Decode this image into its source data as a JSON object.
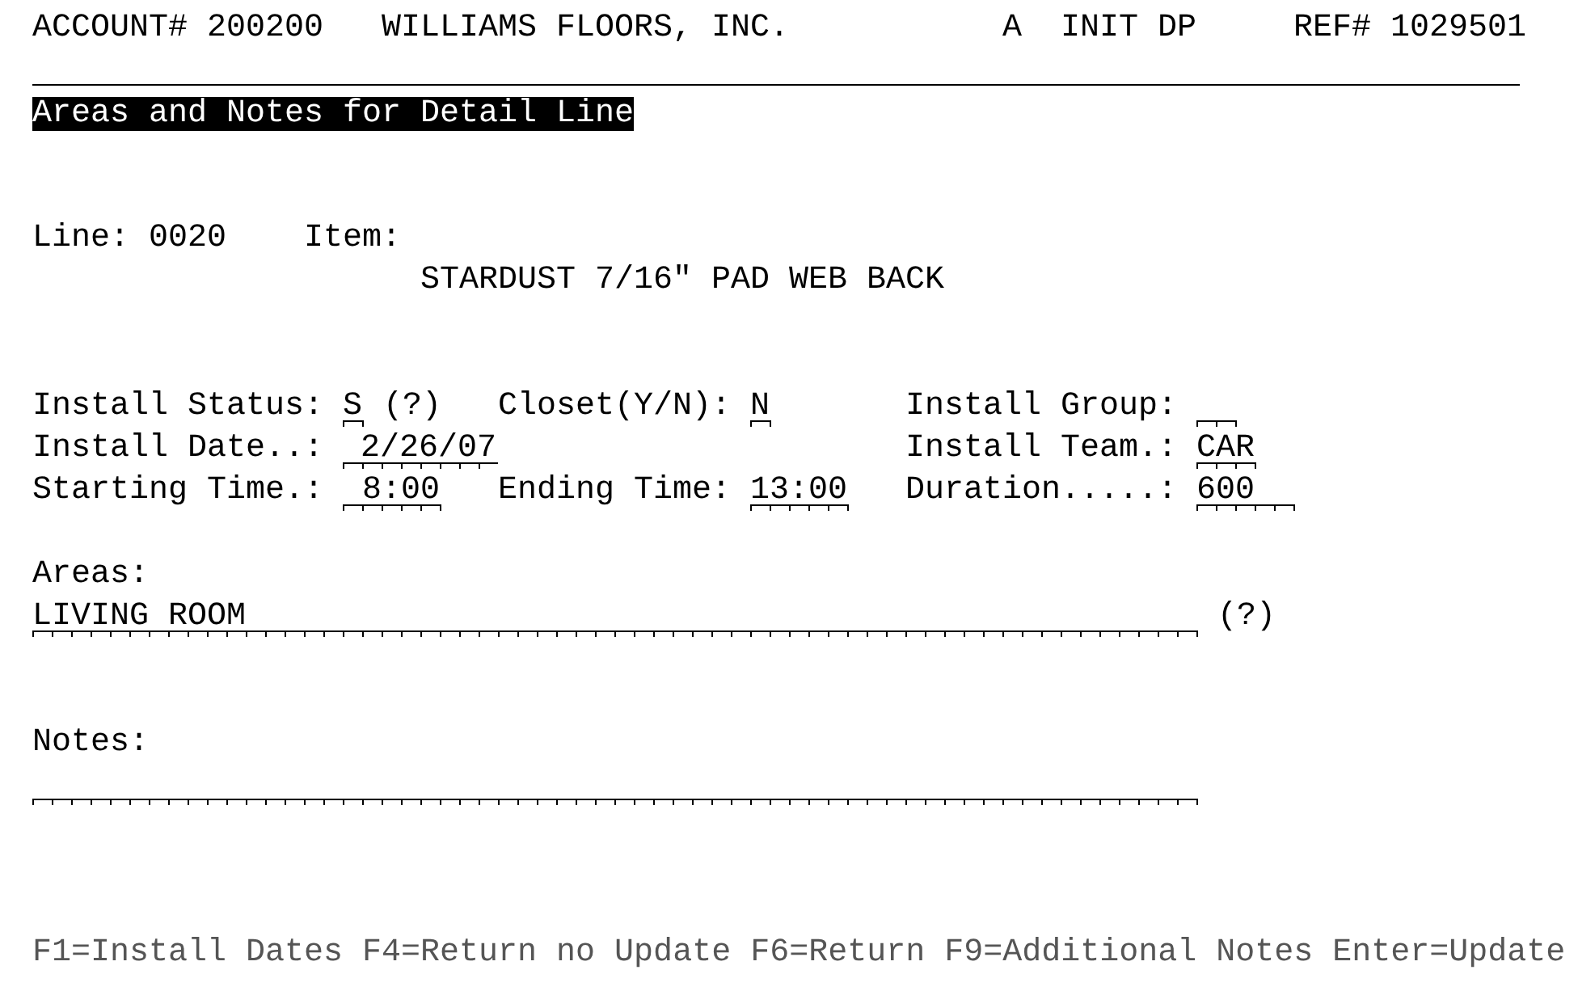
{
  "header": {
    "account": "ACCOUNT# 200200",
    "company": "WILLIAMS FLOORS, INC.",
    "status_code": "A",
    "mode": "INIT DP",
    "reference": "REF# 1029501"
  },
  "screen_title": "Areas and Notes for Detail Line",
  "detail": {
    "line_label": "Line:",
    "line": "0020",
    "item_label": "Item:",
    "item": "STARDUST 7/16\" PAD WEB BACK"
  },
  "form": {
    "install_status": {
      "label": "Install Status:",
      "value": "S",
      "lookup": "(?)"
    },
    "closet": {
      "label": "Closet(Y/N):",
      "value": "N"
    },
    "install_group": {
      "label": "Install Group:"
    },
    "install_date": {
      "label": "Install Date..:",
      "value": "2/26/07"
    },
    "install_team": {
      "label": "Install Team.:",
      "value": "CAR"
    },
    "starting_time": {
      "label": "Starting Time.:",
      "value": "8:00"
    },
    "ending_time": {
      "label": "Ending Time:",
      "value": "13:00"
    },
    "duration": {
      "label": "Duration.....:",
      "value": "600"
    }
  },
  "areas": {
    "label": "Areas:",
    "value": "LIVING ROOM",
    "lookup": "(?)"
  },
  "notes": {
    "label": "Notes:"
  },
  "function_keys": [
    "F1=Install Dates",
    "F4=Return no Update",
    "F6=Return",
    "F9=Additional Notes",
    "Enter=Update"
  ]
}
